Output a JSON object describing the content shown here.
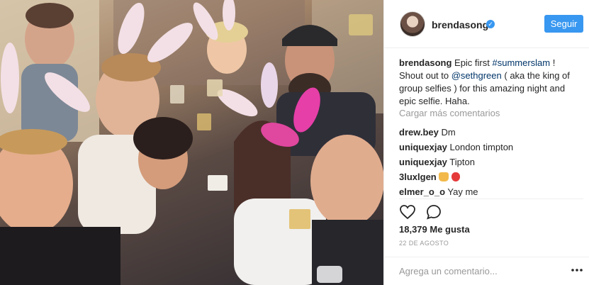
{
  "post": {
    "username": "brendasong",
    "follow_label": "Seguir",
    "verified_icon": "verified-badge-icon",
    "caption": {
      "user": "brendasong",
      "text_1": " Epic first ",
      "hashtag": "#summerslam",
      "text_2": " ! Shout out to ",
      "mention": "@sethgreen",
      "text_3": " ( aka the king of group selfies ) for this amazing night and epic selfie. Haha."
    },
    "load_more": "Cargar más comentarios",
    "comments": [
      {
        "user": "drew.bey",
        "text": " Dm"
      },
      {
        "user": "uniquexjay",
        "text": " London timpton"
      },
      {
        "user": "uniquexjay",
        "text": " Tipton"
      },
      {
        "user": "3luxlgen",
        "text": " "
      },
      {
        "user": "elmer_o_o",
        "text": " Yay me"
      }
    ],
    "likes": "18,379 Me gusta",
    "date": "22 DE AGOSTO",
    "comment_placeholder": "Agrega un comentario...",
    "accent_color": "#3897f0"
  }
}
